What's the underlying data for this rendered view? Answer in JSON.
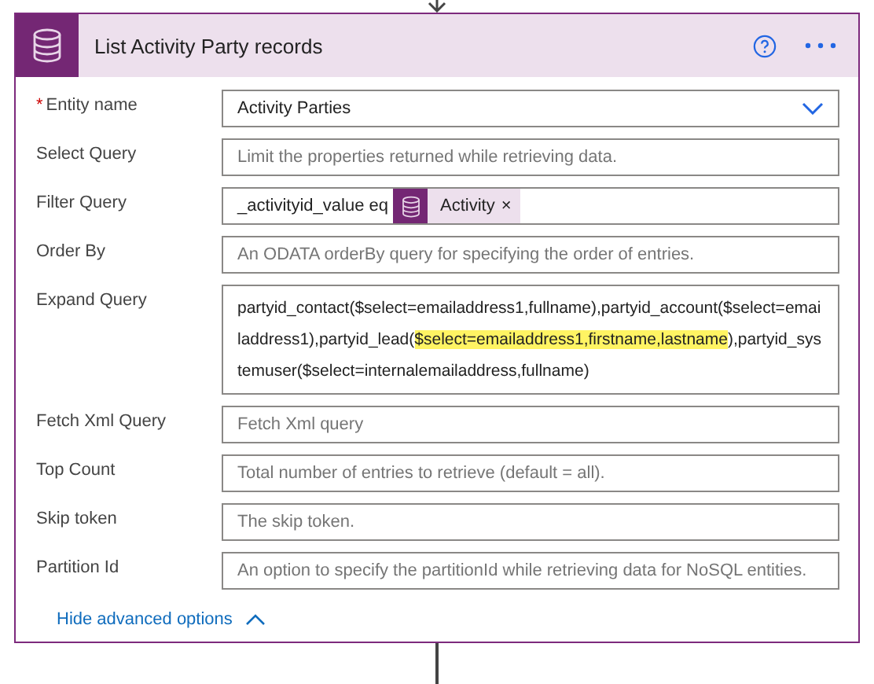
{
  "card": {
    "title": "List Activity Party records"
  },
  "fields": [
    {
      "kind": "dropdown",
      "label": "Entity name",
      "required_mark": "*",
      "value": "Activity Parties"
    },
    {
      "kind": "text",
      "label": "Select Query",
      "placeholder": "Limit the properties returned while retrieving data."
    },
    {
      "kind": "token",
      "label": "Filter Query",
      "value": "_activityid_value eq",
      "token": "Activity",
      "token_close": "×"
    },
    {
      "kind": "text",
      "label": "Order By",
      "placeholder": "An ODATA orderBy query for specifying the order of entries."
    },
    {
      "kind": "multiline",
      "label": "Expand Query",
      "segments": [
        {
          "text": "partyid_contact($select=emailaddress1,fullname),partyid_account($select=emailaddress1),partyid_lead(",
          "highlighted": false
        },
        {
          "text": "$select=emailaddress1,firstname,lastname",
          "highlighted": true
        },
        {
          "text": "),partyid_systemuser($select=internalemailaddress,fullname)",
          "highlighted": false
        }
      ]
    },
    {
      "kind": "text",
      "label": "Fetch Xml Query",
      "placeholder": "Fetch Xml query"
    },
    {
      "kind": "text",
      "label": "Top Count",
      "placeholder": "Total number of entries to retrieve (default = all)."
    },
    {
      "kind": "text",
      "label": "Skip token",
      "placeholder": "The skip token."
    },
    {
      "kind": "text",
      "label": "Partition Id",
      "placeholder": "An option to specify the partitionId while retrieving data for NoSQL entities."
    }
  ],
  "advanced_toggle": {
    "label": "Hide advanced options",
    "expanded": true
  }
}
